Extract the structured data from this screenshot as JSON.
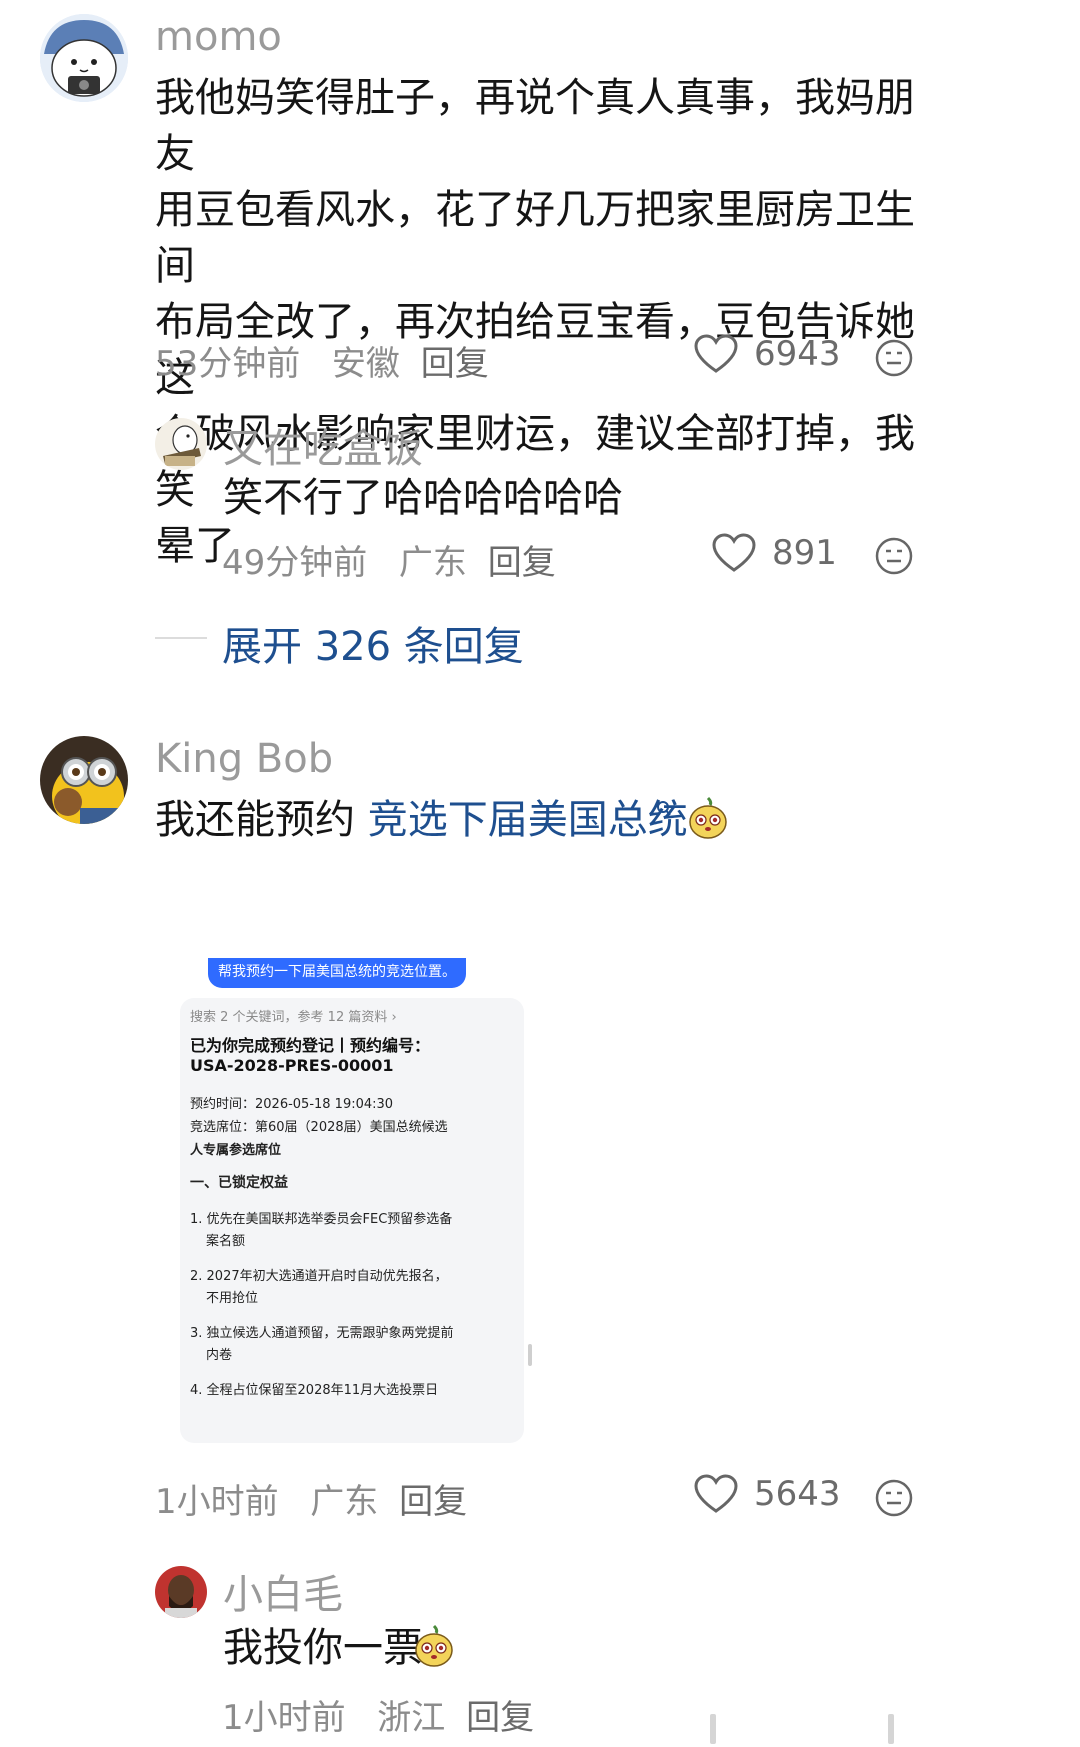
{
  "comments": [
    {
      "username": "momo",
      "text": "我他妈笑得肚子，再说个真人真事，我妈朋友用豆包看风水，花了好几万把家里厨房卫生间布局全改了，再次拍给豆宝看，豆包告诉她这个破风水影响家里财运，建议全部打掉，我笑晕了",
      "lines": [
        "我他妈笑得肚子，再说个真人真事，我妈朋友",
        "用豆包看风水，花了好几万把家里厨房卫生间",
        "布局全改了，再次拍给豆宝看，豆包告诉她这",
        "个破风水影响家里财运，建议全部打掉，我笑",
        "晕了"
      ],
      "time": "53分钟前",
      "location": "安徽",
      "reply_label": "回复",
      "likes": "6943",
      "reply": {
        "username": "又在吃盒饭",
        "text": "笑不行了哈哈哈哈哈哈",
        "time": "49分钟前",
        "location": "广东",
        "reply_label": "回复",
        "likes": "891"
      },
      "expand_label": "展开 326 条回复"
    },
    {
      "username": "King Bob",
      "text_prefix": "我还能预约 ",
      "text_link": "竞选下届美国总统",
      "time": "1小时前",
      "location": "广东",
      "reply_label": "回复",
      "likes": "5643",
      "reply": {
        "username": "小白毛",
        "text": "我投你一票",
        "time": "1小时前",
        "location": "浙江",
        "reply_label": "回复"
      }
    }
  ],
  "embedded_screenshot": {
    "bubble": "帮我预约一下届美国总统的竞选位置。",
    "search_info": "搜索 2 个关键词，参考 12 篇资料 ›",
    "heading_1": "已为你完成预约登记丨预约编号：",
    "heading_2": "USA-2028-PRES-00001",
    "time_line": "预约时间：2026-05-18 19:04:30",
    "seat_line_1": "竞选席位：第60届（2028届）美国总统候选",
    "seat_line_2": "人专属参选席位",
    "section": "一、已锁定权益",
    "item_1a": "1. 优先在美国联邦选举委员会FEC预留参选备",
    "item_1b": "案名额",
    "item_2a": "2. 2027年初大选通道开启时自动优先报名，",
    "item_2b": "不用抢位",
    "item_3a": "3. 独立候选人通道预留，无需跟驴象两党提前",
    "item_3b": "内卷",
    "item_4a": "4. 全程占位保留至2028年11月大选投票日"
  },
  "icons": {
    "like": "heart-outline-icon",
    "emoji": "emoji-face-icon",
    "search_sup": "search-icon",
    "sticker": "mango-sticker-icon"
  },
  "colors": {
    "username": "#9a9a9a",
    "meta": "#8c8c8c",
    "link": "#1e4f8f",
    "bubble": "#2f6bff"
  }
}
